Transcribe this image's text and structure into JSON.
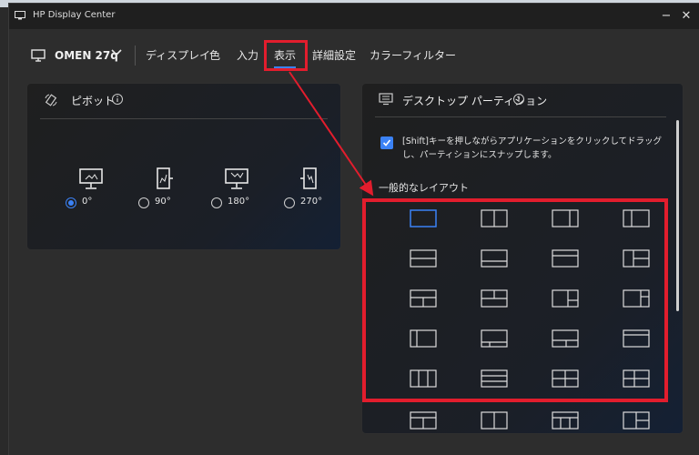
{
  "window": {
    "title": "HP Display Center"
  },
  "nav": {
    "monitor": "OMEN 27q",
    "tabs": [
      "ディスプレイ",
      "色",
      "入力",
      "表示",
      "詳細設定",
      "カラーフィルター"
    ],
    "active_tab": "表示"
  },
  "pivot": {
    "title": "ピボット",
    "options": [
      {
        "label": "0°",
        "checked": true
      },
      {
        "label": "90°",
        "checked": false
      },
      {
        "label": "180°",
        "checked": false
      },
      {
        "label": "270°",
        "checked": false
      }
    ]
  },
  "partition": {
    "title": "デスクトップ パーティション",
    "checkbox_label": "[Shift]キーを押しながらアプリケーションをクリックしてドラッグし、パーティションにスナップします。",
    "checkbox_checked": true,
    "layout_heading": "一般的なレイアウト"
  },
  "colors": {
    "accent": "#3b82f6",
    "annotation": "#e21d2d"
  }
}
